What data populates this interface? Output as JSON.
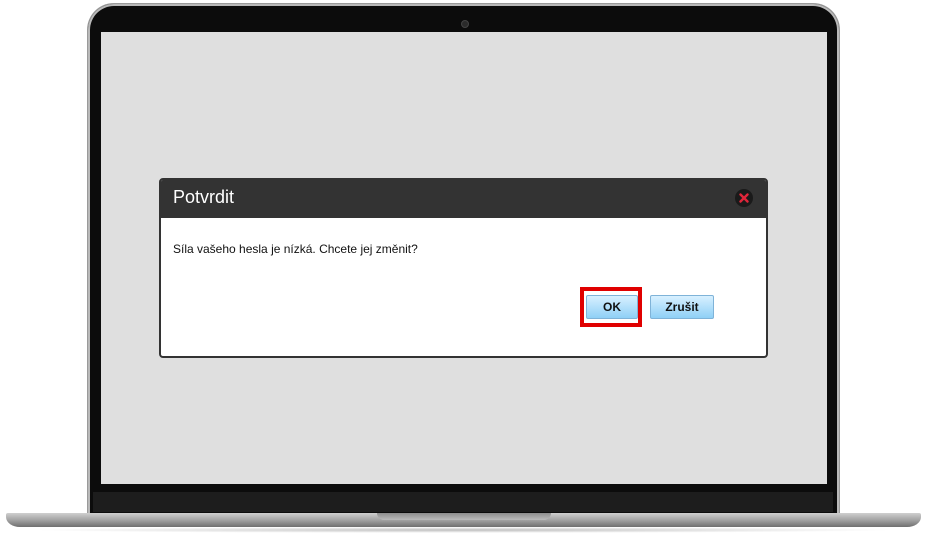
{
  "dialog": {
    "title": "Potvrdit",
    "message": "Síla vašeho hesla je nízká. Chcete jej změnit?",
    "ok_label": "OK",
    "cancel_label": "Zrušit",
    "close_icon": "close-icon"
  },
  "colors": {
    "header_bg": "#333333",
    "screen_bg": "#dfdfdf",
    "button_top": "#d8f0ff",
    "button_bottom": "#8fd0f6",
    "highlight": "#e00000",
    "close_x": "#e0263a"
  }
}
